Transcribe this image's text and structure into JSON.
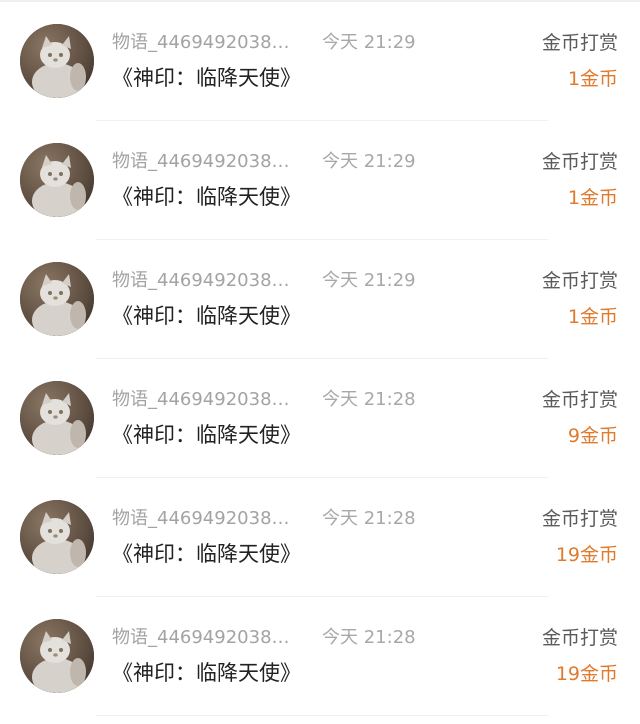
{
  "items": [
    {
      "user": "物语_4469492038…",
      "time": "今天 21:29",
      "title": "《神印：临降天使》",
      "reward_label": "金币打赏",
      "amount": "1金币"
    },
    {
      "user": "物语_4469492038…",
      "time": "今天 21:29",
      "title": "《神印：临降天使》",
      "reward_label": "金币打赏",
      "amount": "1金币"
    },
    {
      "user": "物语_4469492038…",
      "time": "今天 21:29",
      "title": "《神印：临降天使》",
      "reward_label": "金币打赏",
      "amount": "1金币"
    },
    {
      "user": "物语_4469492038…",
      "time": "今天 21:28",
      "title": "《神印：临降天使》",
      "reward_label": "金币打赏",
      "amount": "9金币"
    },
    {
      "user": "物语_4469492038…",
      "time": "今天 21:28",
      "title": "《神印：临降天使》",
      "reward_label": "金币打赏",
      "amount": "19金币"
    },
    {
      "user": "物语_4469492038…",
      "time": "今天 21:28",
      "title": "《神印：临降天使》",
      "reward_label": "金币打赏",
      "amount": "19金币"
    }
  ],
  "avatar_icon": "cat-avatar-icon",
  "colors": {
    "amount": "#e07a2c",
    "meta": "#a3a3a3",
    "title": "#222222"
  }
}
